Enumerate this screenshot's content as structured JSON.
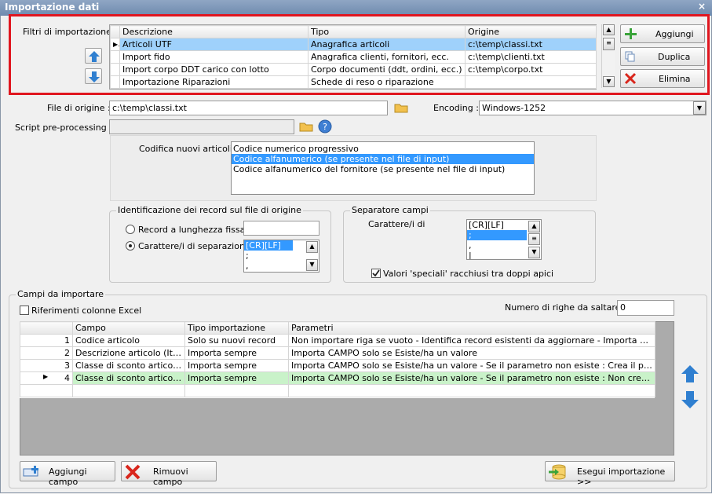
{
  "window": {
    "title": "Importazione dati",
    "close": "×"
  },
  "filters": {
    "label": "Filtri di importazione :",
    "columns": [
      "Descrizione",
      "Tipo",
      "Origine"
    ],
    "rows": [
      {
        "descrizione": "Articoli UTF",
        "tipo": "Anagrafica articoli",
        "origine": "c:\\temp\\classi.txt"
      },
      {
        "descrizione": "Import fido",
        "tipo": "Anagrafica clienti, fornitori, ecc.",
        "origine": "c:\\temp\\clienti.txt"
      },
      {
        "descrizione": "Import corpo DDT carico con lotto",
        "tipo": "Corpo documenti (ddt, ordini, ecc.)",
        "origine": "c:\\temp\\corpo.txt"
      },
      {
        "descrizione": "Importazione Riparazioni",
        "tipo": "Schede di reso o riparazione",
        "origine": ""
      }
    ],
    "buttons": {
      "add": "Aggiungi",
      "duplicate": "Duplica",
      "delete": "Elimina"
    }
  },
  "source": {
    "label": "File di origine :",
    "value": "c:\\temp\\classi.txt"
  },
  "encoding": {
    "label": "Encoding :",
    "value": "Windows-1252"
  },
  "script": {
    "label": "Script pre-processing :",
    "value": ""
  },
  "coding": {
    "label": "Codifica nuovi articoli :",
    "options": [
      "Codice numerico progressivo",
      "Codice alfanumerico (se presente nel file di input)",
      "Codice alfanumerico del fornitore (se presente nel file di input)"
    ],
    "selected_index": 1
  },
  "identification": {
    "legend": "Identificazione dei record sul file di origine",
    "fixed_label": "Record a lunghezza fissa",
    "fixed_value": "",
    "sep_label": "Carattere/i di separazione",
    "sep_items": [
      "[CR][LF]",
      ";",
      ","
    ]
  },
  "separator": {
    "legend": "Separatore campi",
    "label": "Carattere/i di",
    "items": [
      "[CR][LF]",
      ";",
      ",",
      "|"
    ],
    "quotes_label": "Valori 'speciali' racchiusi tra doppi apici",
    "quotes_checked": true
  },
  "fields": {
    "legend": "Campi da importare",
    "excel_label": "Riferimenti colonne Excel",
    "skip_label": "Numero di righe da saltare :",
    "skip_value": "0",
    "columns": [
      "Campo",
      "Tipo importazione",
      "Parametri"
    ],
    "rows": [
      {
        "n": "1",
        "campo": "Codice articolo",
        "tipo": "Solo su nuovi record",
        "param": "Non importare riga se vuoto - Identifica record esistenti da aggiornare - Importa CAMPO solo ..."
      },
      {
        "n": "2",
        "campo": "Descrizione articolo (Italia...",
        "tipo": "Importa sempre",
        "param": "Importa CAMPO solo se Esiste/ha un valore"
      },
      {
        "n": "3",
        "campo": "Classe di sconto articoli : ...",
        "tipo": "Importa sempre",
        "param": "Importa CAMPO solo se Esiste/ha un valore  - Se il parametro non esiste : Crea il parametro u..."
      },
      {
        "n": "4",
        "campo": "Classe di sconto articoli : ...",
        "tipo": "Importa sempre",
        "param": "Importa CAMPO solo se Esiste/ha un valore  - Se il parametro non esiste : Non creare il param..."
      }
    ],
    "add_button": "Aggiungi campo",
    "remove_button": "Rimuovi campo",
    "run_button": "Esegui importazione >>"
  },
  "colors": {
    "accent_red": "#e0161f",
    "selection": "#3399ff",
    "row_green": "#c9f2c9",
    "arrow_blue": "#2f7fd0"
  }
}
